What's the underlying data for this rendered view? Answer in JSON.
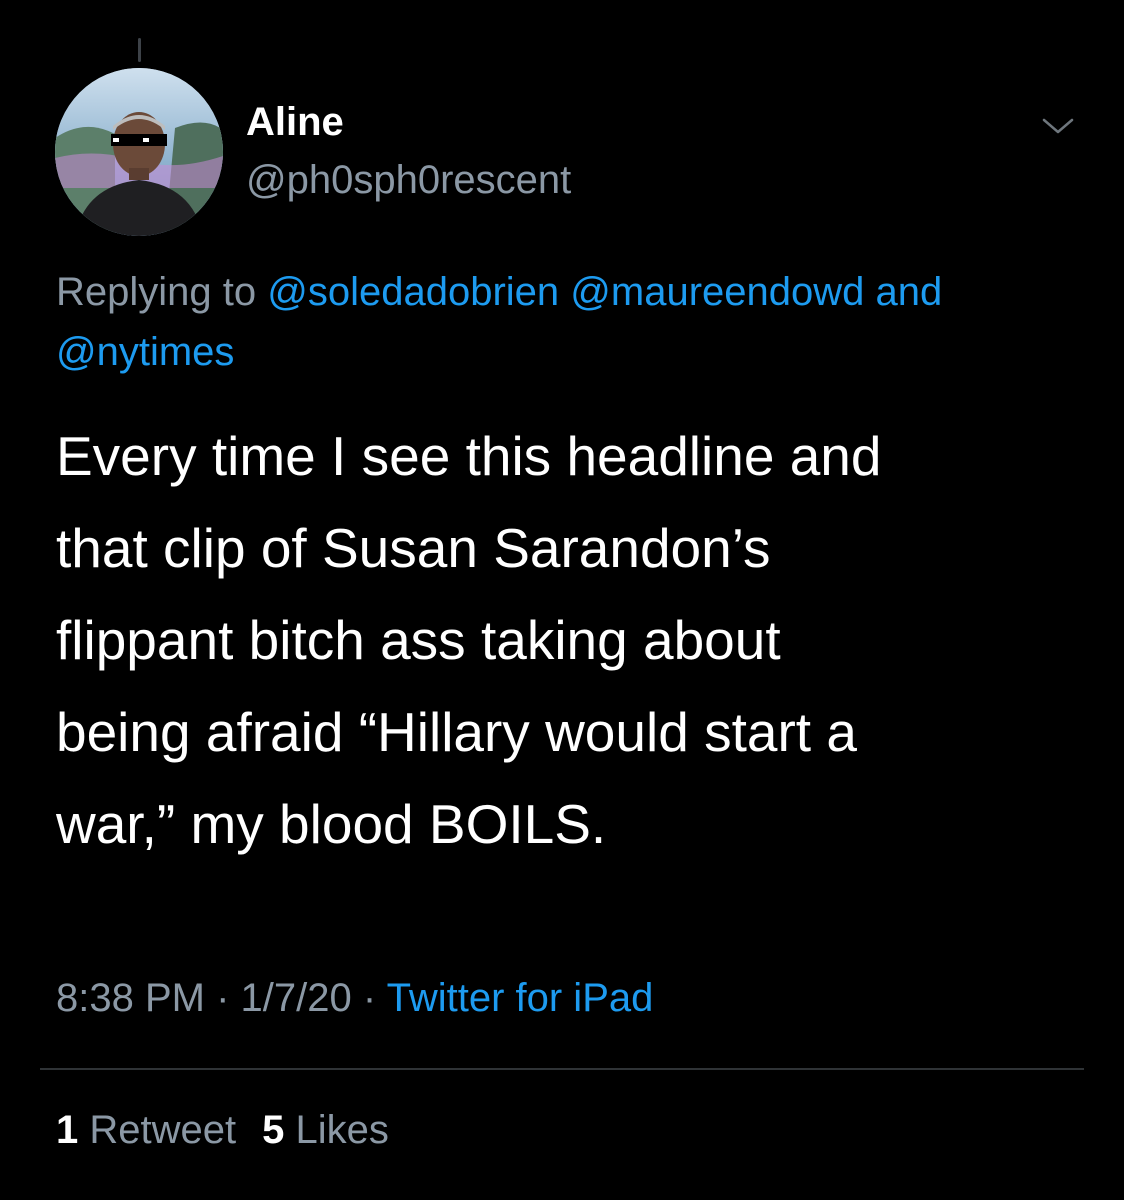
{
  "author": {
    "display_name": "Aline",
    "handle": "@ph0sph0rescent"
  },
  "reply": {
    "prefix": "Replying to",
    "mention_1": "@soledadobrien",
    "mention_2": "@maureendowd",
    "conjunction": "and",
    "mention_3": "@nytimes"
  },
  "tweet": {
    "lines": [
      "Every time I see this headline and",
      "that clip of Susan Sarandon’s",
      "flippant bitch ass taking about",
      "being afraid “Hillary would start a",
      "war,” my blood BOILS."
    ]
  },
  "meta": {
    "time": "8:38 PM",
    "separator": "·",
    "date": "1/7/20",
    "source": "Twitter for iPad"
  },
  "stats": {
    "retweet_count": "1",
    "retweet_label": "Retweet",
    "like_count": "5",
    "like_label": "Likes"
  },
  "icons": {
    "menu": "chevron-down-icon",
    "avatar": "avatar"
  },
  "colors": {
    "background": "#000000",
    "text": "#ffffff",
    "secondary": "#8b98a5",
    "link": "#1d9bf0",
    "divider": "#2f3336"
  }
}
